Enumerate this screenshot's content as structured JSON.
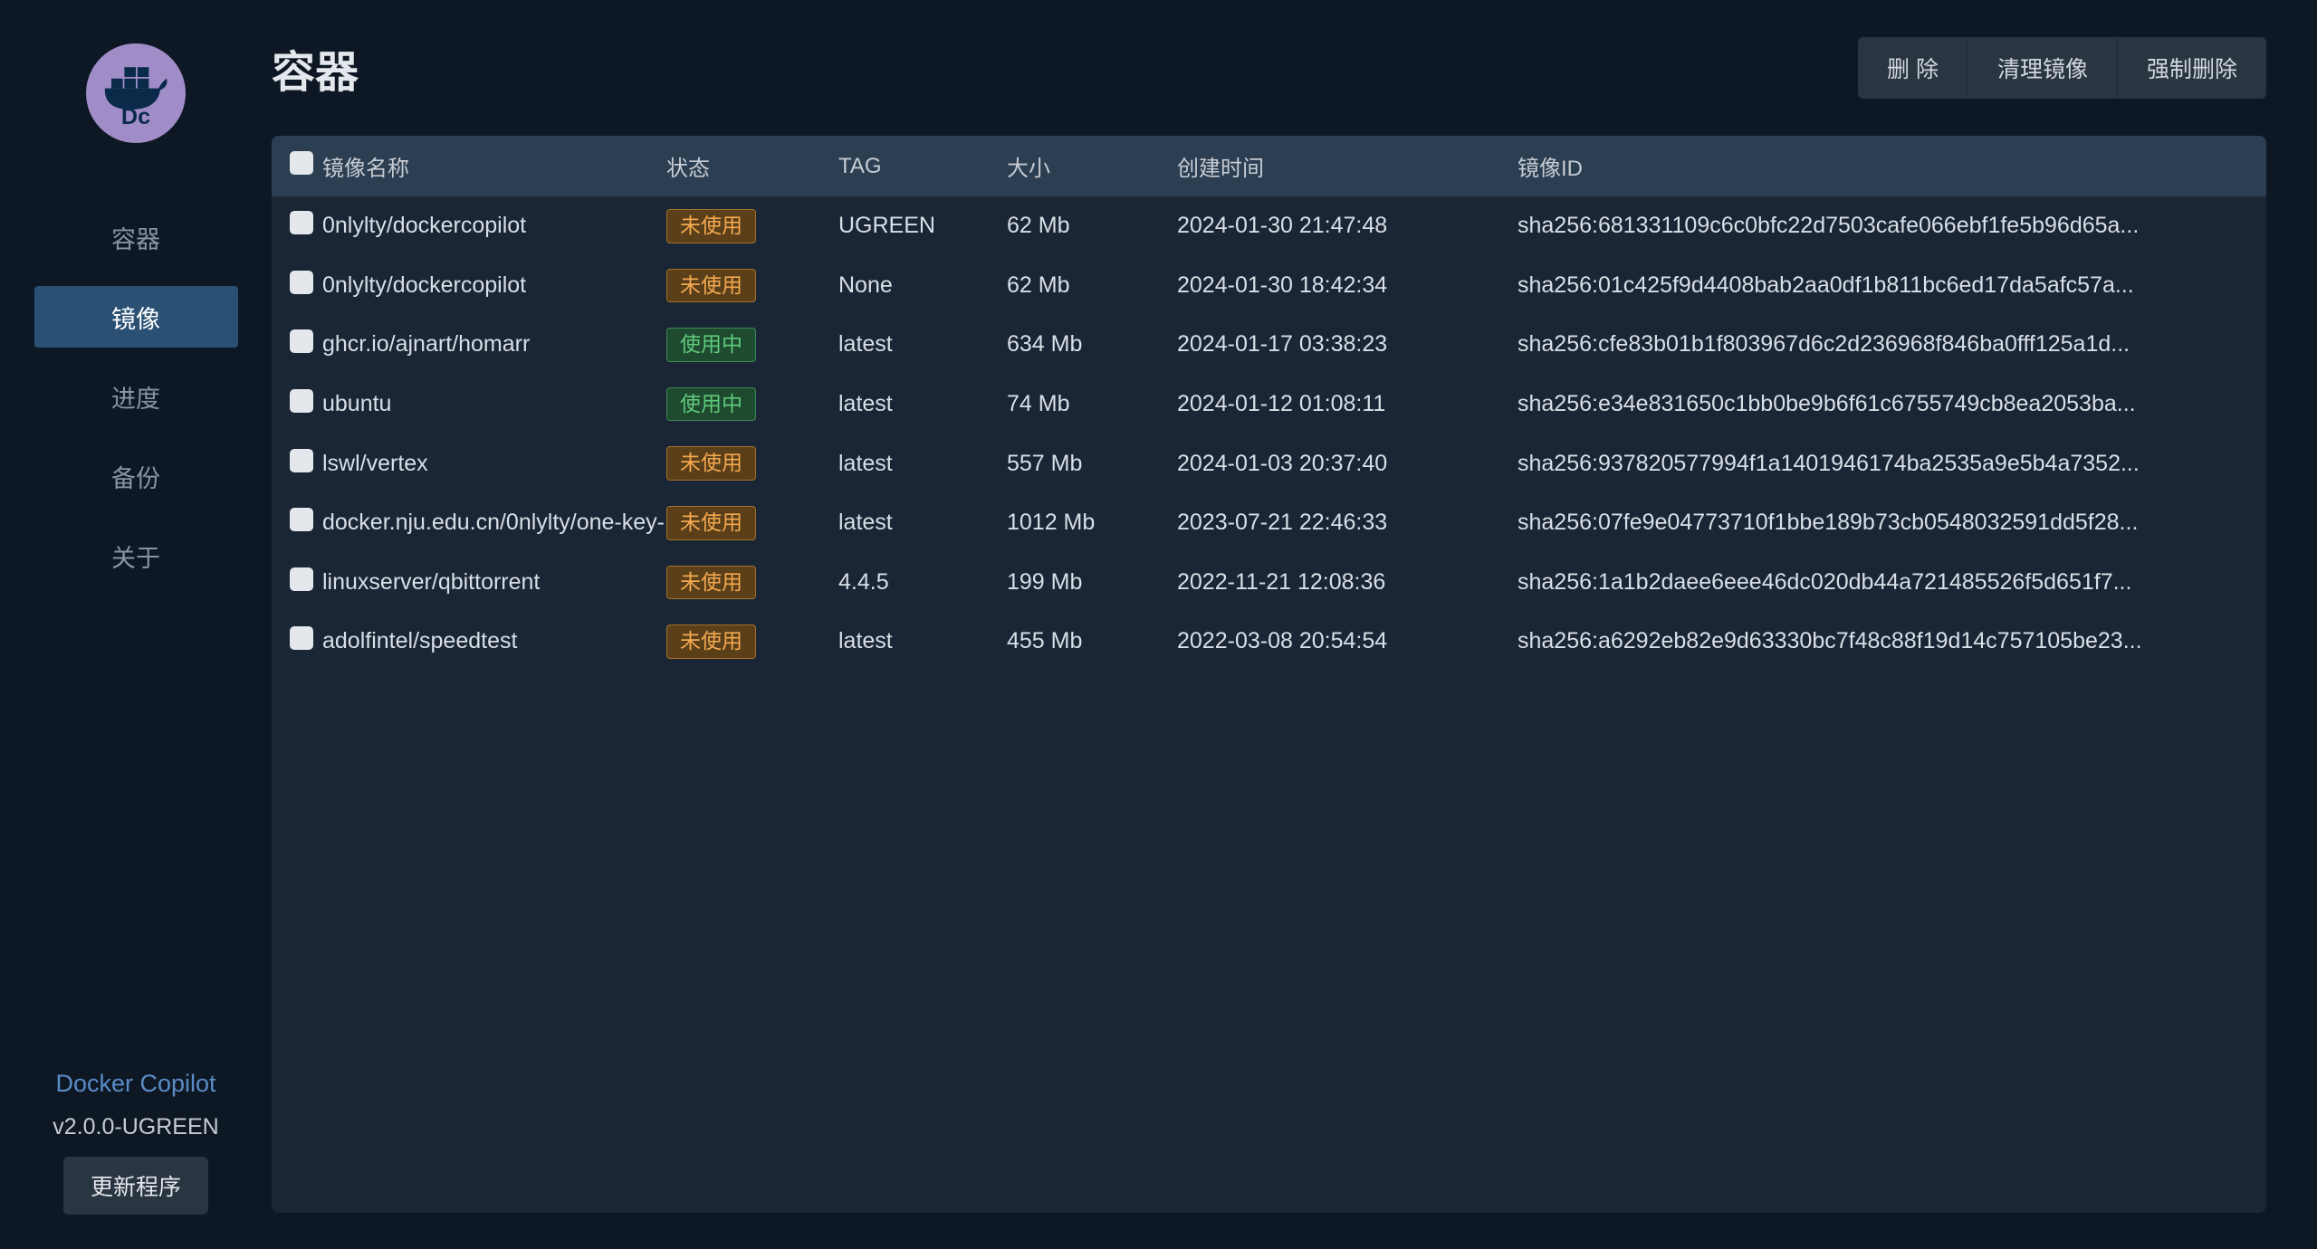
{
  "sidebar": {
    "nav": [
      {
        "label": "容器",
        "active": false
      },
      {
        "label": "镜像",
        "active": true
      },
      {
        "label": "进度",
        "active": false
      },
      {
        "label": "备份",
        "active": false
      },
      {
        "label": "关于",
        "active": false
      }
    ],
    "app_name": "Docker Copilot",
    "app_version": "v2.0.0-UGREEN",
    "update_btn": "更新程序"
  },
  "header": {
    "title": "容器",
    "actions": [
      {
        "label": "删 除"
      },
      {
        "label": "清理镜像"
      },
      {
        "label": "强制删除"
      }
    ]
  },
  "table": {
    "columns": {
      "name": "镜像名称",
      "status": "状态",
      "tag": "TAG",
      "size": "大小",
      "created": "创建时间",
      "id": "镜像ID"
    },
    "status_labels": {
      "unused": "未使用",
      "used": "使用中"
    },
    "rows": [
      {
        "name": "0nlylty/dockercopilot",
        "status": "unused",
        "tag": "UGREEN",
        "size": "62 Mb",
        "created": "2024-01-30 21:47:48",
        "id": "sha256:681331109c6c0bfc22d7503cafe066ebf1fe5b96d65a..."
      },
      {
        "name": "0nlylty/dockercopilot",
        "status": "unused",
        "tag": "None",
        "size": "62 Mb",
        "created": "2024-01-30 18:42:34",
        "id": "sha256:01c425f9d4408bab2aa0df1b811bc6ed17da5afc57a..."
      },
      {
        "name": "ghcr.io/ajnart/homarr",
        "status": "used",
        "tag": "latest",
        "size": "634 Mb",
        "created": "2024-01-17 03:38:23",
        "id": "sha256:cfe83b01b1f803967d6c2d236968f846ba0fff125a1d..."
      },
      {
        "name": "ubuntu",
        "status": "used",
        "tag": "latest",
        "size": "74 Mb",
        "created": "2024-01-12 01:08:11",
        "id": "sha256:e34e831650c1bb0be9b6f61c6755749cb8ea2053ba..."
      },
      {
        "name": "lswl/vertex",
        "status": "unused",
        "tag": "latest",
        "size": "557 Mb",
        "created": "2024-01-03 20:37:40",
        "id": "sha256:937820577994f1a1401946174ba2535a9e5b4a7352..."
      },
      {
        "name": "docker.nju.edu.cn/0nlylty/one-key-",
        "status": "unused",
        "tag": "latest",
        "size": "1012 Mb",
        "created": "2023-07-21 22:46:33",
        "id": "sha256:07fe9e04773710f1bbe189b73cb0548032591dd5f28..."
      },
      {
        "name": "linuxserver/qbittorrent",
        "status": "unused",
        "tag": "4.4.5",
        "size": "199 Mb",
        "created": "2022-11-21 12:08:36",
        "id": "sha256:1a1b2daee6eee46dc020db44a721485526f5d651f7..."
      },
      {
        "name": "adolfintel/speedtest",
        "status": "unused",
        "tag": "latest",
        "size": "455 Mb",
        "created": "2022-03-08 20:54:54",
        "id": "sha256:a6292eb82e9d63330bc7f48c88f19d14c757105be23..."
      }
    ]
  }
}
